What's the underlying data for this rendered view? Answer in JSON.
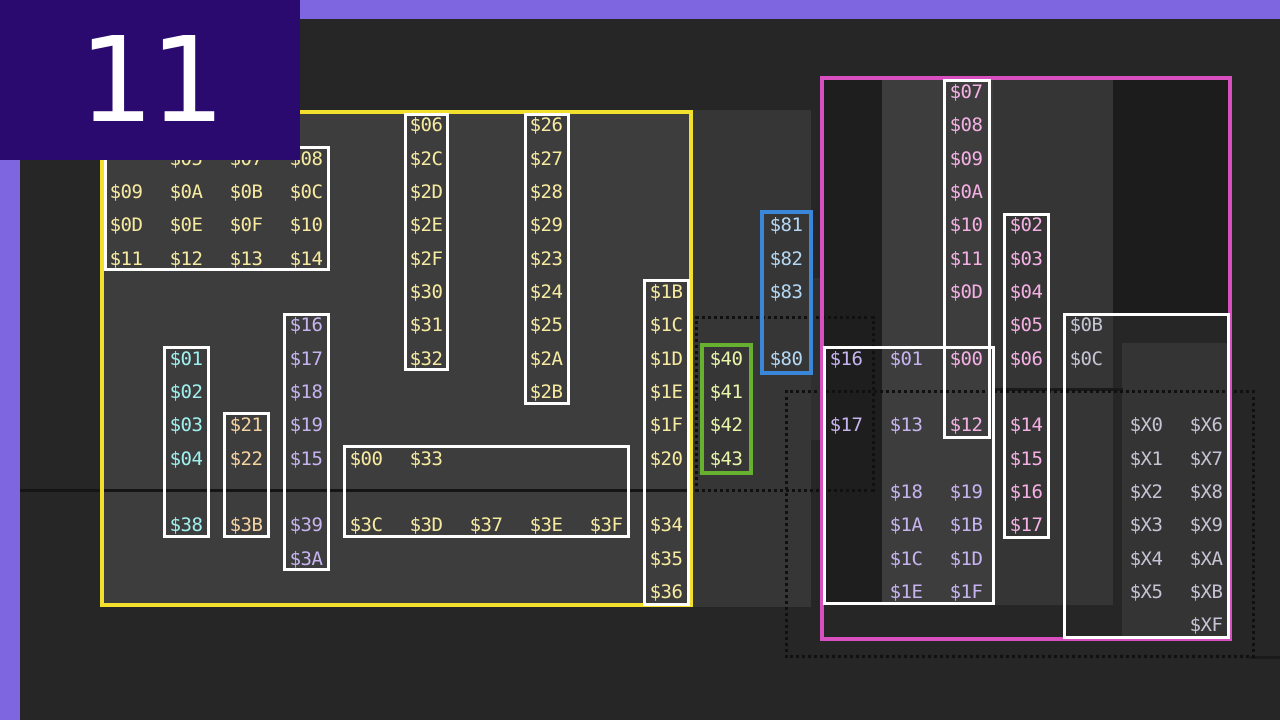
{
  "episode_number": "11",
  "colors": {
    "background": "#262626",
    "accent_bar": "#7e66e0",
    "badge_bg": "#2a0a6e",
    "yellow_region": "#f2e02c",
    "magenta_region": "#d84fc0",
    "blue_region": "#3a86d8",
    "green_region": "#68b030",
    "white_box": "#ffffff",
    "text_yellow": "#f6eaa0",
    "text_cyan": "#9ef0ee",
    "text_peach": "#f6d2a0",
    "text_violet": "#c6b4f0",
    "text_blue": "#b4d8f4",
    "text_green": "#e8f4a8",
    "text_pink": "#f4b0e4",
    "text_gray": "#c4c4d4"
  },
  "groups": [
    {
      "color": "text_yellow",
      "labels": [
        "$05",
        "$07",
        "$08",
        "$09",
        "$0A",
        "$0B",
        "$0C",
        "$0D",
        "$0E",
        "$0F",
        "$10",
        "$11",
        "$12",
        "$13",
        "$14"
      ]
    },
    {
      "color": "text_yellow",
      "labels": [
        "$06",
        "$2C",
        "$2D",
        "$2E",
        "$2F",
        "$30",
        "$31",
        "$32"
      ]
    },
    {
      "color": "text_yellow",
      "labels": [
        "$26",
        "$27",
        "$28",
        "$29",
        "$23",
        "$24",
        "$25",
        "$2A",
        "$2B"
      ]
    },
    {
      "color": "text_yellow",
      "labels": [
        "$1B",
        "$1C",
        "$1D",
        "$1E",
        "$1F",
        "$20",
        "$34",
        "$35",
        "$36"
      ]
    },
    {
      "color": "text_yellow",
      "labels": [
        "$00",
        "$33",
        "$3C",
        "$3D",
        "$37",
        "$3E",
        "$3F"
      ]
    },
    {
      "color": "text_cyan",
      "labels": [
        "$01",
        "$02",
        "$03",
        "$04",
        "$38"
      ]
    },
    {
      "color": "text_peach",
      "labels": [
        "$21",
        "$22",
        "$3B"
      ]
    },
    {
      "color": "text_violet",
      "labels": [
        "$16",
        "$17",
        "$18",
        "$19",
        "$15",
        "$39",
        "$3A"
      ]
    },
    {
      "color": "text_blue",
      "labels": [
        "$81",
        "$82",
        "$83",
        "$80"
      ]
    },
    {
      "color": "text_green",
      "labels": [
        "$40",
        "$41",
        "$42",
        "$43"
      ]
    },
    {
      "color": "text_pink",
      "labels": [
        "$07",
        "$08",
        "$09",
        "$0A",
        "$10",
        "$11",
        "$0D",
        "$00",
        "$12"
      ]
    },
    {
      "color": "text_pink",
      "labels": [
        "$02",
        "$03",
        "$04",
        "$05",
        "$06",
        "$14",
        "$15",
        "$16",
        "$17"
      ]
    },
    {
      "color": "text_violet",
      "labels": [
        "$16",
        "$01",
        "$17",
        "$13",
        "$18",
        "$19",
        "$1A",
        "$1B",
        "$1C",
        "$1D",
        "$1E",
        "$1F"
      ]
    },
    {
      "color": "text_gray",
      "labels": [
        "$0B",
        "$0C",
        "$X0",
        "$X1",
        "$X2",
        "$X3",
        "$X4",
        "$X5",
        "$X6",
        "$X7",
        "$X8",
        "$X9",
        "$XA",
        "$XB",
        "$XF"
      ]
    }
  ]
}
